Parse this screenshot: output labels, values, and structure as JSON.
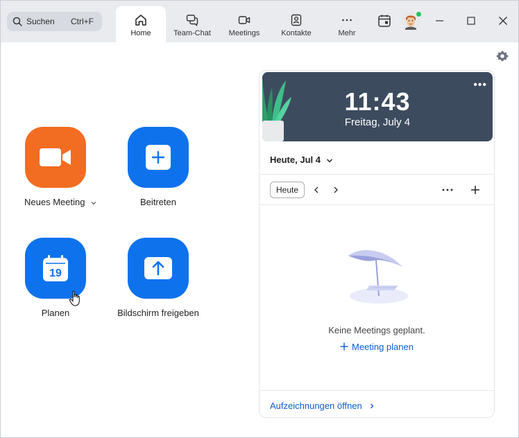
{
  "search": {
    "label": "Suchen",
    "shortcut": "Ctrl+F",
    "icon": "search-icon"
  },
  "tabs": [
    {
      "label": "Home",
      "icon": "home-icon",
      "active": true
    },
    {
      "label": "Team-Chat",
      "icon": "chat-icon",
      "active": false
    },
    {
      "label": "Meetings",
      "icon": "video-icon",
      "active": false
    },
    {
      "label": "Kontakte",
      "icon": "contacts-icon",
      "active": false
    },
    {
      "label": "Mehr",
      "icon": "more-icon",
      "active": false
    }
  ],
  "actions": {
    "new_meeting": "Neues Meeting",
    "join": "Beitreten",
    "schedule": "Planen",
    "share_screen": "Bildschirm freigeben",
    "schedule_day": "19"
  },
  "calendar": {
    "time": "11:43",
    "date": "Freitag, July 4",
    "day_header": "Heute, Jul 4",
    "today_button": "Heute",
    "more": "•••",
    "empty_text": "Keine Meetings geplant.",
    "plan_link": "Meeting planen",
    "recordings_link": "Aufzeichnungen öffnen"
  },
  "colors": {
    "orange": "#f26d21",
    "blue": "#0e72ed",
    "link": "#0b5cd5",
    "banner": "#3d4b5e",
    "presence": "#23c55e"
  }
}
